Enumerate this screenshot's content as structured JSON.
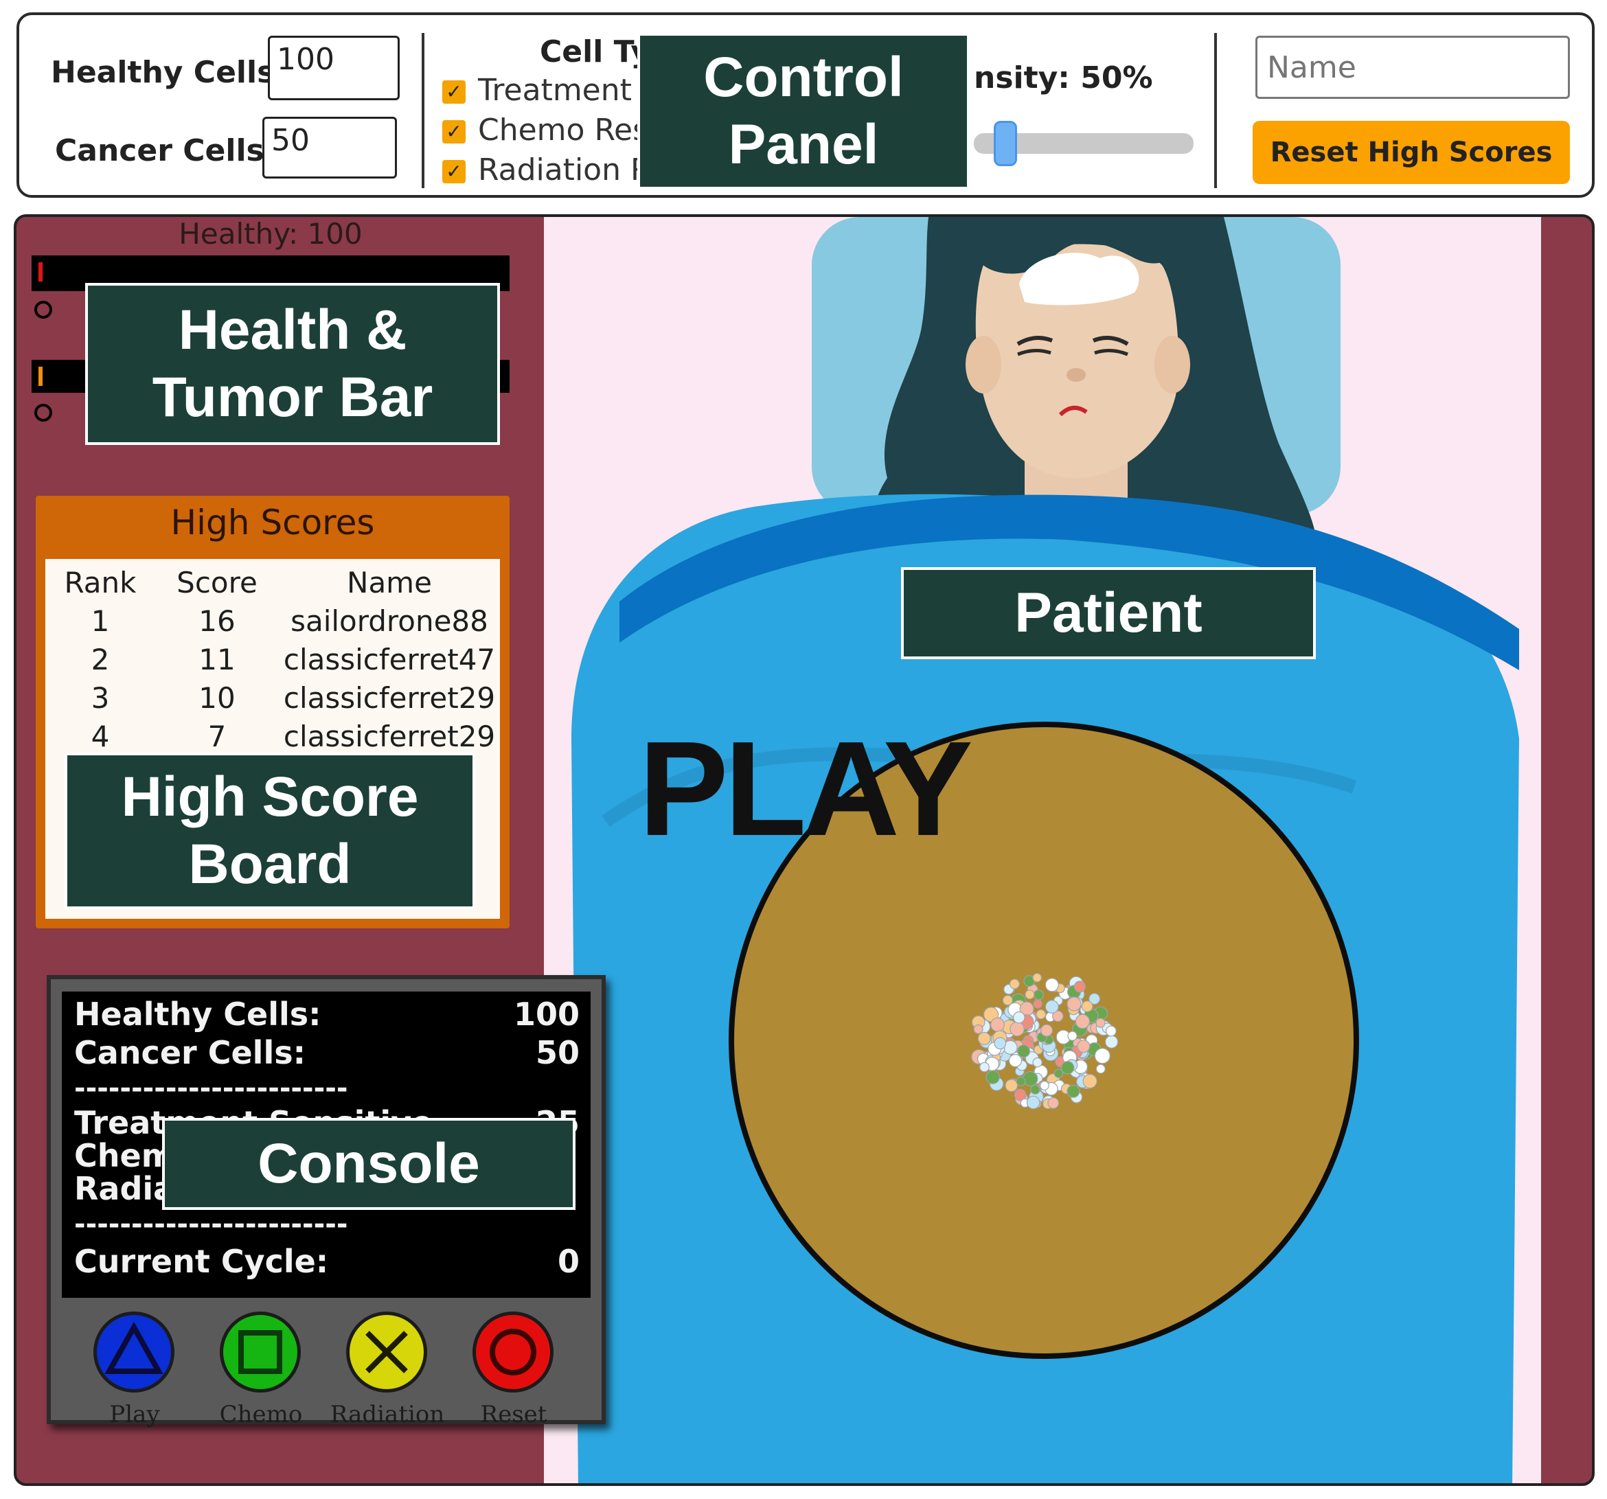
{
  "control_panel": {
    "healthy_cells_label": "Healthy Cells",
    "healthy_cells_value": "100",
    "cancer_cells_label": "Cancer Cells",
    "cancer_cells_value": "50",
    "cell_types_title": "Cell Ty",
    "cell_types": [
      {
        "label": "Treatment S",
        "checked": true
      },
      {
        "label": "Chemo Res",
        "checked": true
      },
      {
        "label": "Radiation R",
        "checked": true
      }
    ],
    "intensity_label": "nsity: 50%",
    "intensity_value": 0.5,
    "name_placeholder": "Name",
    "reset_high_scores_label": "Reset High Scores",
    "accent_color": "#fba100",
    "slider_color": "#6fb1f5"
  },
  "health_bars": {
    "healthy_label": "Healthy: 100"
  },
  "high_scores": {
    "title": "High Scores",
    "columns": [
      "Rank",
      "Score",
      "Name"
    ],
    "rows": [
      {
        "rank": "1",
        "score": "16",
        "name": "sailordrone88"
      },
      {
        "rank": "2",
        "score": "11",
        "name": "classicferret47"
      },
      {
        "rank": "3",
        "score": "10",
        "name": "classicferret29"
      },
      {
        "rank": "4",
        "score": "7",
        "name": "classicferret29"
      }
    ]
  },
  "console": {
    "healthy_label": "Healthy Cells:",
    "healthy_value": "100",
    "cancer_label": "Cancer Cells:",
    "cancer_value": "50",
    "separator": "------------------------",
    "treatment_label": "Treatment Sensitive",
    "treatment_value": "25",
    "chemo_label": "Chem",
    "radiation_label": "Radia",
    "cycle_label": "Current Cycle:",
    "cycle_value": "0",
    "buttons": [
      {
        "label": "Play",
        "color": "#0a2fd6",
        "icon": "triangle-icon"
      },
      {
        "label": "Chemo",
        "color": "#15b512",
        "icon": "square-icon"
      },
      {
        "label": "Radiation",
        "color": "#d6d60a",
        "icon": "x-icon"
      },
      {
        "label": "Reset",
        "color": "#e40d0d",
        "icon": "circle-icon"
      }
    ]
  },
  "game": {
    "play_text": "PLAY",
    "petri_color": "#b08a35",
    "blanket_color": "#2ba6e0",
    "frame_color": "#8b3a4a"
  },
  "callouts": {
    "control_panel": "Control Panel",
    "health_tumor_bar": "Health & Tumor Bar",
    "high_score_board": "High Score Board",
    "patient": "Patient",
    "console": "Console"
  }
}
